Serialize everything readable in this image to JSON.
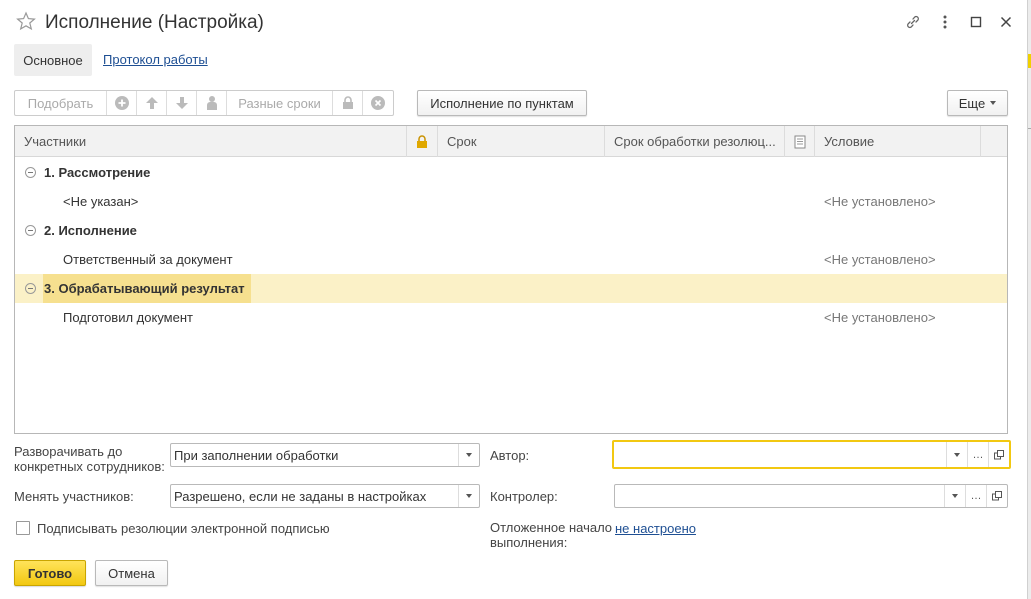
{
  "window": {
    "title": "Исполнение (Настройка)"
  },
  "tabs": [
    {
      "label": "Основное"
    },
    {
      "label": "Протокол работы"
    }
  ],
  "toolbar": {
    "pick_label": "Подобрать",
    "diff_terms_label": "Разные сроки",
    "by_items_label": "Исполнение по пунктам",
    "more_label": "Еще"
  },
  "table": {
    "columns": [
      "Участники",
      "Срок",
      "Срок обработки резолюц...",
      "Условие"
    ],
    "rows": [
      {
        "kind": "group",
        "label": "1. Рассмотрение",
        "condition": ""
      },
      {
        "kind": "item",
        "label": "<Не указан>",
        "condition": "<Не установлено>"
      },
      {
        "kind": "group",
        "label": "2. Исполнение",
        "condition": ""
      },
      {
        "kind": "item",
        "label": "Ответственный за документ",
        "condition": "<Не установлено>"
      },
      {
        "kind": "group",
        "label": "3. Обрабатывающий результат",
        "condition": "",
        "selected": true
      },
      {
        "kind": "item",
        "label": "Подготовил документ",
        "condition": "<Не установлено>"
      }
    ]
  },
  "form": {
    "expand_label": "Разворачивать до конкретных сотрудников:",
    "expand_value": "При заполнении обработки",
    "change_label": "Менять участников:",
    "change_value": "Разрешено, если не заданы в настройках",
    "author_label": "Автор:",
    "author_value": "",
    "controller_label": "Контролер:",
    "controller_value": "",
    "sign_label": "Подписывать резолюции электронной подписью",
    "sign_checked": false,
    "deferred_label": "Отложенное начало выполнения:",
    "deferred_value": "не настроено"
  },
  "buttons": {
    "ok_label": "Готово",
    "cancel_label": "Отмена"
  },
  "colors": {
    "accent_yellow": "#f2c811",
    "selected_row": "#fbf1c7",
    "link": "#1e4f93"
  }
}
